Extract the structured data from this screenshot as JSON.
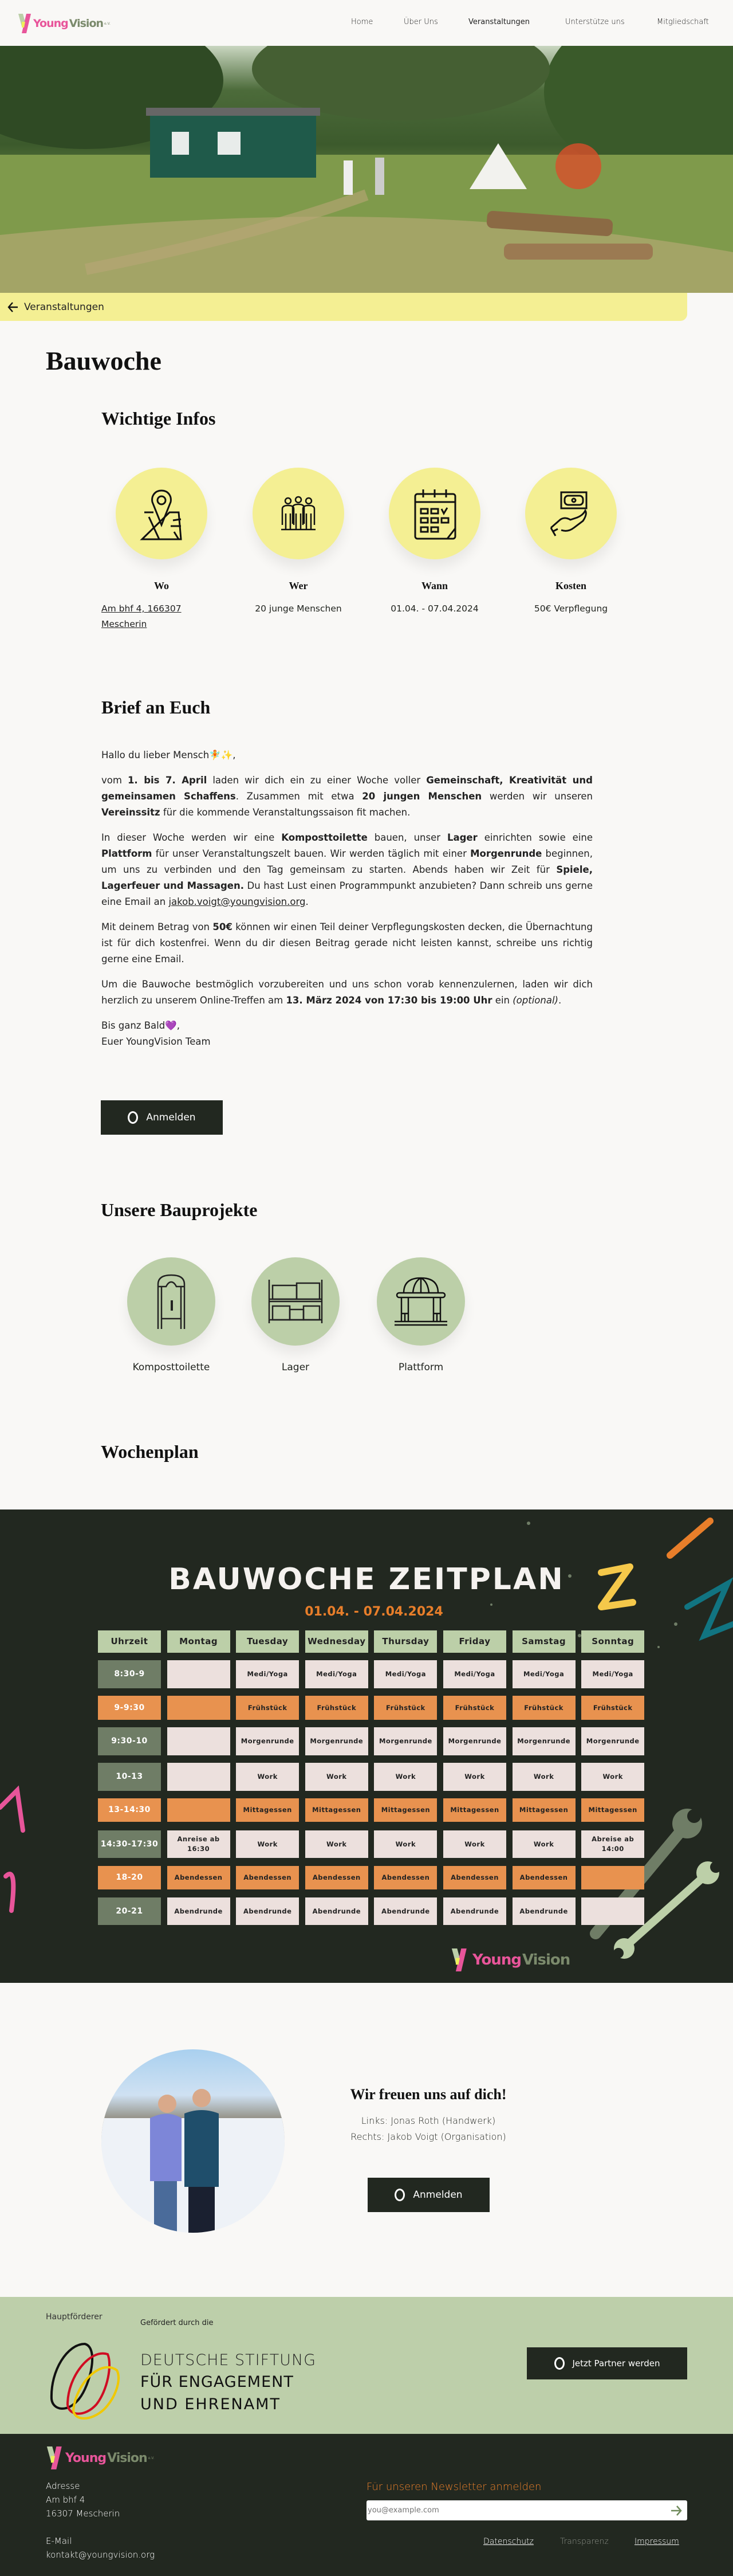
{
  "header": {
    "logo": {
      "text1": "Young",
      "text2": "Vision",
      "suffix": "e.V."
    },
    "nav": [
      "Home",
      "Über Uns",
      "Veranstaltungen",
      "Unterstütze uns",
      "Mitgliedschaft"
    ]
  },
  "back_link": "Veranstaltungen",
  "page_title": "Bauwoche",
  "infos": {
    "heading": "Wichtige Infos",
    "items": [
      {
        "label": "Wo",
        "value": "Am bhf 4, 166307 Mescherin",
        "icon": "map-pin-icon"
      },
      {
        "label": "Wer",
        "value": "20 junge Menschen",
        "icon": "people-icon"
      },
      {
        "label": "Wann",
        "value": "01.04. - 07.04.2024",
        "icon": "calendar-icon"
      },
      {
        "label": "Kosten",
        "value": "50€ Verpflegung",
        "icon": "money-hand-icon"
      }
    ]
  },
  "letter": {
    "heading": "Brief an Euch",
    "paragraphs": [
      [
        [
          "Hallo du lieber Mensch🧚✨,",
          ""
        ]
      ],
      [
        [
          "vom ",
          ""
        ],
        [
          "1. bis 7. April",
          "b"
        ],
        [
          " laden wir dich ein zu einer Woche voller ",
          ""
        ],
        [
          "Gemeinschaft, Kreativität und gemeinsamen Schaffens",
          "b"
        ],
        [
          ". Zusammen mit etwa ",
          ""
        ],
        [
          "20 jungen Menschen",
          "b"
        ],
        [
          " werden wir unseren ",
          ""
        ],
        [
          "Vereinssitz",
          "b"
        ],
        [
          " für die kommende Veranstaltungssaison fit machen.",
          ""
        ]
      ],
      [
        [
          "In dieser Woche werden wir eine ",
          ""
        ],
        [
          "Komposttoilette",
          "b"
        ],
        [
          " bauen, unser ",
          ""
        ],
        [
          "Lager",
          "b"
        ],
        [
          " einrichten sowie eine ",
          ""
        ],
        [
          "Plattform",
          "b"
        ],
        [
          " für unser Veranstaltungszelt bauen. Wir werden täglich mit einer ",
          ""
        ],
        [
          "Morgenrunde",
          "b"
        ],
        [
          " beginnen, um uns zu verbinden und den Tag gemeinsam zu starten. Abends haben wir Zeit für ",
          ""
        ],
        [
          "Spiele, Lagerfeuer und Massagen.",
          "b"
        ],
        [
          " Du hast Lust einen Programmpunkt anzubieten? Dann schreib uns gerne eine Email an ",
          ""
        ],
        [
          "jakob.voigt@youngvision.org",
          "a"
        ],
        [
          ".",
          ""
        ]
      ],
      [
        [
          "Mit deinem Betrag von ",
          ""
        ],
        [
          "50€",
          "b"
        ],
        [
          " können wir einen Teil deiner Verpflegungskosten decken, die Übernachtung ist für dich kostenfrei. Wenn du dir diesen Beitrag gerade nicht leisten kannst, schreibe uns richtig gerne eine Email.",
          ""
        ]
      ],
      [
        [
          "Um die Bauwoche bestmöglich vorzubereiten und uns schon vorab kennenzulernen, laden wir dich herzlich zu unserem Online-Treffen am ",
          ""
        ],
        [
          "13. März 2024 von 17:30 bis 19:00 Uhr",
          "b"
        ],
        [
          " ein ",
          ""
        ],
        [
          "(optional)",
          "i"
        ],
        [
          ".",
          ""
        ]
      ],
      [
        [
          "Bis ganz Bald💜,",
          ""
        ],
        [
          "\nEuer YoungVision Team",
          ""
        ]
      ]
    ]
  },
  "register_label": "Anmelden",
  "projects": {
    "heading": "Unsere Bauprojekte",
    "items": [
      {
        "label": "Komposttoilette",
        "icon": "toilet-icon"
      },
      {
        "label": "Lager",
        "icon": "shelf-icon"
      },
      {
        "label": "Plattform",
        "icon": "pavilion-icon"
      }
    ]
  },
  "weekplan": {
    "heading": "Wochenplan",
    "title": "BAUWOCHE ZEITPLAN",
    "dates": "01.04. - 07.04.2024",
    "columns": [
      "Uhrzeit",
      "Montag",
      "Tuesday",
      "Wednesday",
      "Thursday",
      "Friday",
      "Samstag",
      "Sonntag"
    ],
    "rows": [
      {
        "time": "8:30-9",
        "kind": "activity",
        "cells": [
          "",
          "Medi/Yoga",
          "Medi/Yoga",
          "Medi/Yoga",
          "Medi/Yoga",
          "Medi/Yoga",
          "Medi/Yoga"
        ]
      },
      {
        "time": "9-9:30",
        "kind": "meal",
        "cells": [
          "",
          "Frühstück",
          "Frühstück",
          "Frühstück",
          "Frühstück",
          "Frühstück",
          "Frühstück"
        ]
      },
      {
        "time": "9:30-10",
        "kind": "activity",
        "cells": [
          "",
          "Morgenrunde",
          "Morgenrunde",
          "Morgenrunde",
          "Morgenrunde",
          "Morgenrunde",
          "Morgenrunde"
        ]
      },
      {
        "time": "10-13",
        "kind": "activity",
        "cells": [
          "",
          "Work",
          "Work",
          "Work",
          "Work",
          "Work",
          "Work"
        ]
      },
      {
        "time": "13-14:30",
        "kind": "meal",
        "cells": [
          "",
          "Mittagessen",
          "Mittagessen",
          "Mittagessen",
          "Mittagessen",
          "Mittagessen",
          "Mittagessen"
        ]
      },
      {
        "time": "14:30-17:30",
        "kind": "activity",
        "cells": [
          "Anreise ab 16:30",
          "Work",
          "Work",
          "Work",
          "Work",
          "Work",
          "Abreise ab 14:00"
        ]
      },
      {
        "time": "18-20",
        "kind": "meal",
        "cells": [
          "Abendessen",
          "Abendessen",
          "Abendessen",
          "Abendessen",
          "Abendessen",
          "Abendessen",
          ""
        ]
      },
      {
        "time": "20-21",
        "kind": "activity",
        "cells": [
          "Abendrunde",
          "Abendrunde",
          "Abendrunde",
          "Abendrunde",
          "Abendrunde",
          "Abendrunde",
          ""
        ]
      }
    ],
    "colors": {
      "bg": "#222820",
      "header": "#bccfa8",
      "time_activity": "#6f7d66",
      "meal": "#e8924f",
      "cell": "#ece0dd",
      "dates": "#e87e2a"
    }
  },
  "team": {
    "heading": "Wir freuen uns auf dich!",
    "line1": "Links: Jonas Roth (Handwerk)",
    "line2": "Rechts: Jakob Voigt (Organisation)"
  },
  "partner": {
    "label": "Hauptförderer",
    "funder_small": "Gefördert durch die",
    "funder_line1": "DEUTSCHE STIFTUNG",
    "funder_line2": "FÜR ENGAGEMENT",
    "funder_line3": "UND EHRENAMT",
    "button": "Jetzt Partner werden"
  },
  "footer": {
    "address_label": "Adresse",
    "address1": "Am bhf 4",
    "address2": "16307 Mescherin",
    "email_label": "E-Mail",
    "email": "kontakt@youngvision.org",
    "newsletter_heading": "Für unseren Newsletter anmelden",
    "newsletter_placeholder": "you@example.com",
    "links": [
      "Datenschutz",
      "Transparenz",
      "Impressum"
    ]
  }
}
